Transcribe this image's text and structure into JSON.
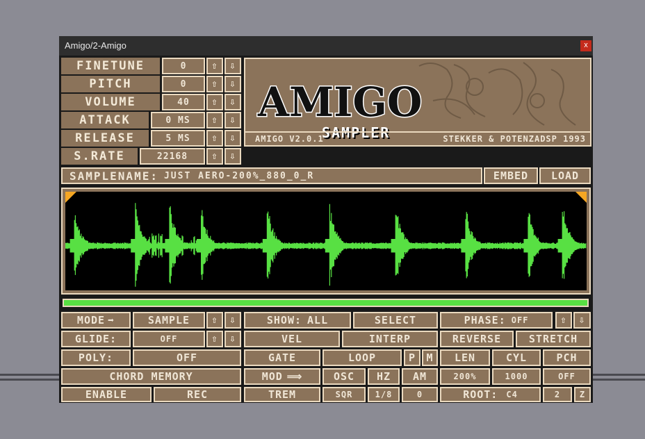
{
  "window": {
    "title": "Amigo/2-Amigo",
    "close": "x"
  },
  "params": {
    "finetune": {
      "label": "FINETUNE",
      "value": "0"
    },
    "pitch": {
      "label": "PITCH",
      "value": "0"
    },
    "volume": {
      "label": "VOLUME",
      "value": "40"
    },
    "attack": {
      "label": "ATTACK",
      "value": "0 MS"
    },
    "release": {
      "label": "RELEASE",
      "value": "5 MS"
    },
    "srate": {
      "label": "S.RATE",
      "value": "22168"
    }
  },
  "logo": {
    "title": "AMIGO",
    "subtitle": "SAMPLER",
    "version": "AMIGO V2.0.1",
    "credit": "STEKKER & POTENZADSP 1993"
  },
  "sample": {
    "label": "SAMPLENAME:",
    "name": "JUST AERO-200%_880_0_R",
    "embed": "EMBED",
    "load": "LOAD"
  },
  "arrows": {
    "up": "⇧",
    "down": "⇩",
    "right": "➡",
    "long_right": "⟹"
  },
  "row1": {
    "mode_label": "MODE",
    "mode_value": "SAMPLE",
    "show_label": "SHOW:",
    "show_value": "ALL",
    "select": "SELECT",
    "phase_label": "PHASE:",
    "phase_value": "OFF"
  },
  "row2": {
    "glide_label": "GLIDE:",
    "glide_value": "OFF",
    "vel": "VEL",
    "interp": "INTERP",
    "reverse": "REVERSE",
    "stretch": "STRETCH"
  },
  "row3": {
    "poly_label": "POLY:",
    "poly_value": "OFF",
    "gate": "GATE",
    "loop": "LOOP",
    "p": "P",
    "m": "M",
    "len": "LEN",
    "cyl": "CYL",
    "pch": "PCH"
  },
  "row4": {
    "chord": "CHORD MEMORY",
    "mod": "MOD",
    "osc": "OSC",
    "hz": "HZ",
    "am": "AM",
    "val1": "200%",
    "val2": "1000",
    "val3": "OFF"
  },
  "row5": {
    "enable": "ENABLE",
    "rec": "REC",
    "trem": "TREM",
    "sqr": "SQR",
    "frac": "1/8",
    "zero": "0",
    "root_label": "ROOT:",
    "root_value": "C4",
    "two": "2",
    "z": "Z"
  },
  "colors": {
    "panel": "#8b735a",
    "border": "#ead9bf",
    "wave": "#58e043",
    "bg": "#000000"
  }
}
